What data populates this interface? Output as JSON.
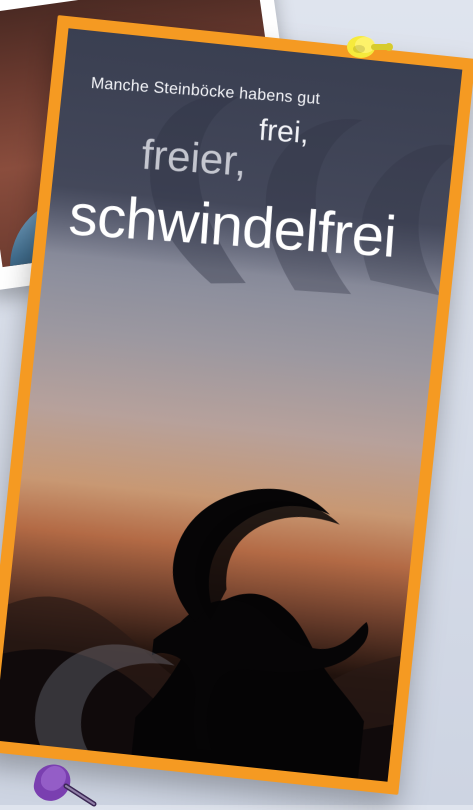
{
  "brochure": {
    "lines": {
      "small": "Manche Steinböcke habens gut",
      "frei": "frei,",
      "freier": "freier,",
      "schwindelfrei": "schwindelfrei"
    },
    "colors": {
      "frame": "#f59a22",
      "top_band": "#3e4254",
      "text": "#ffffff"
    }
  },
  "decor": {
    "yellow_pin": "yellow-pushpin",
    "purple_pin": "purple-pushpin"
  }
}
